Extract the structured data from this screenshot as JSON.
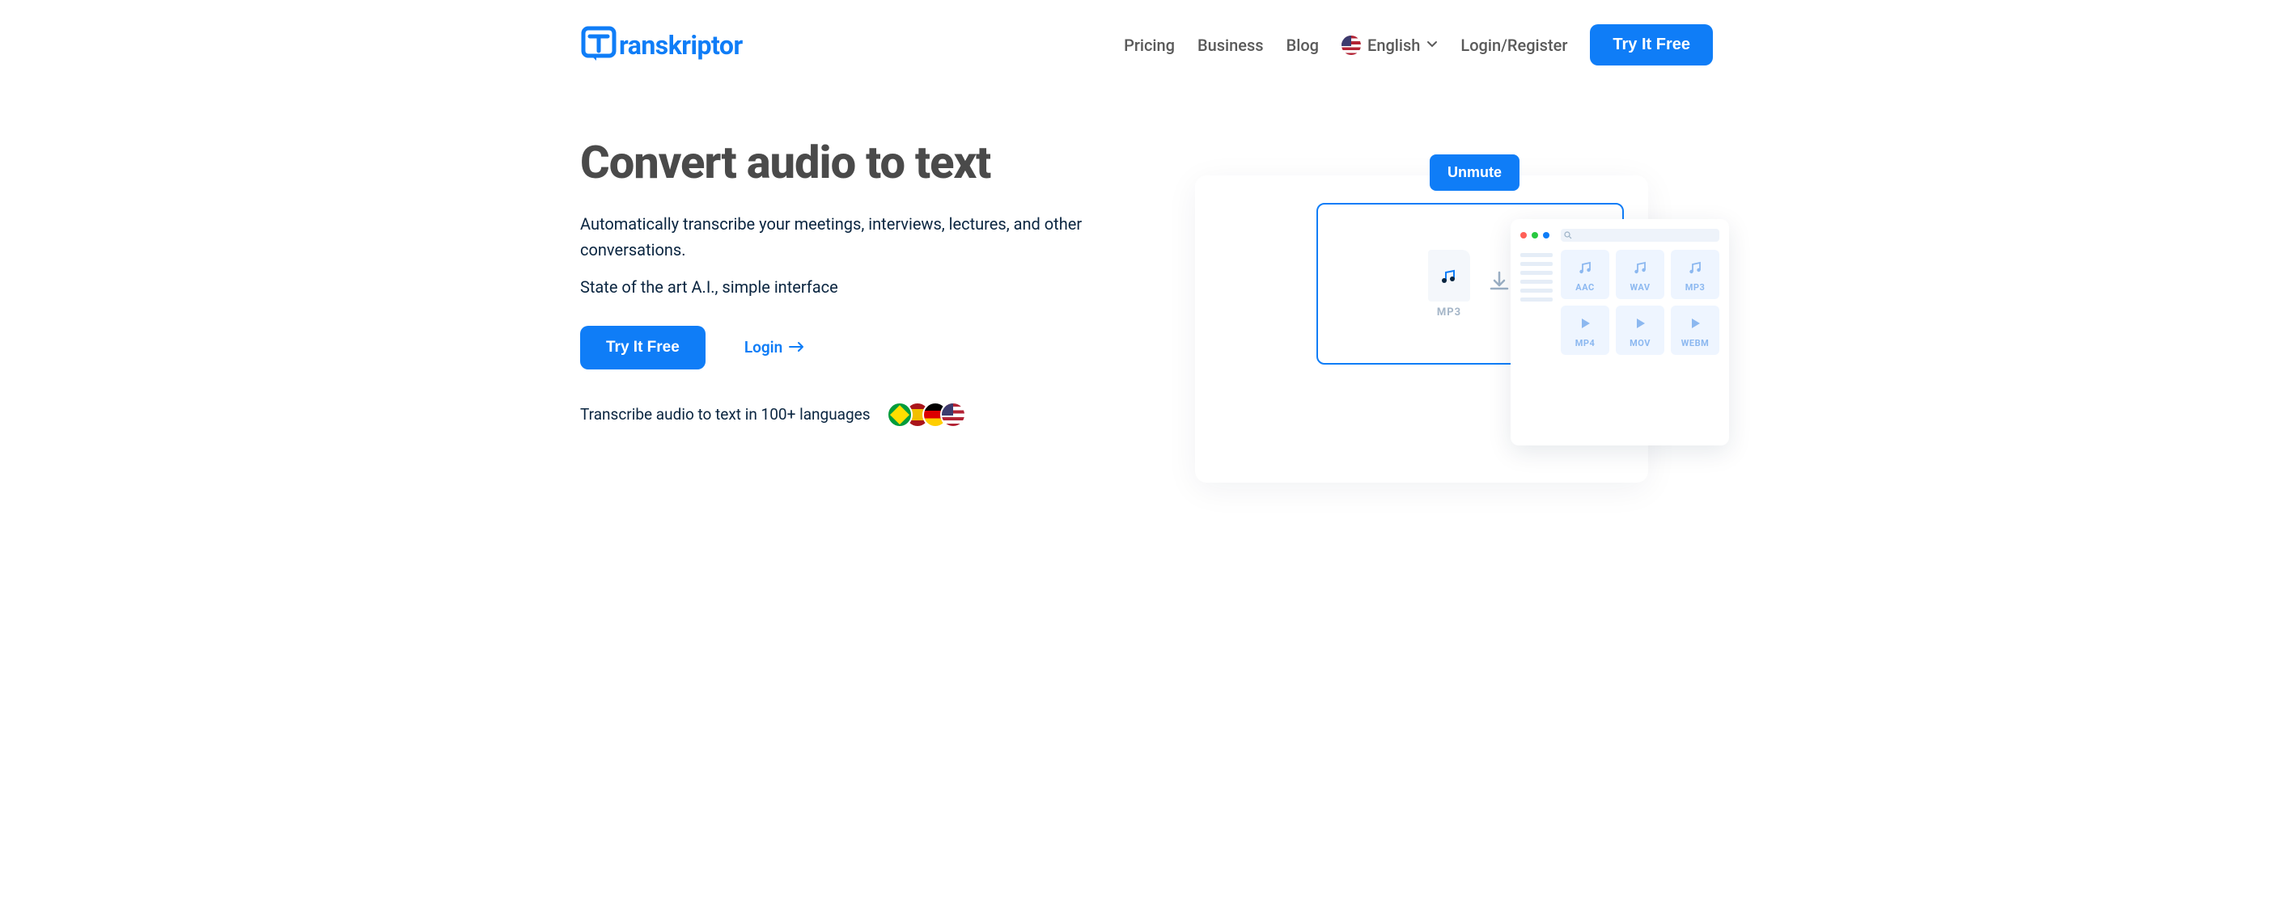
{
  "brand": {
    "name": "ranskriptor"
  },
  "nav": {
    "pricing": "Pricing",
    "business": "Business",
    "blog": "Blog",
    "language": "English",
    "login_register": "Login/Register",
    "cta": "Try It Free"
  },
  "hero": {
    "title": "Convert audio to text",
    "desc": "Automatically transcribe your meetings, interviews, lectures, and other conversations.",
    "subdesc": "State of the art A.I., simple interface",
    "cta": "Try It Free",
    "login": "Login",
    "lang_support": "Transcribe audio to text in 100+ languages"
  },
  "illustration": {
    "unmute": "Unmute",
    "mp3_label": "MP3",
    "file_tiles": [
      "AAC",
      "WAV",
      "MP3",
      "MP4",
      "MOV",
      "WEBM"
    ]
  },
  "colors": {
    "primary": "#0f7df7",
    "text_dark": "#4a4a4a",
    "text_body": "#0a2540"
  }
}
